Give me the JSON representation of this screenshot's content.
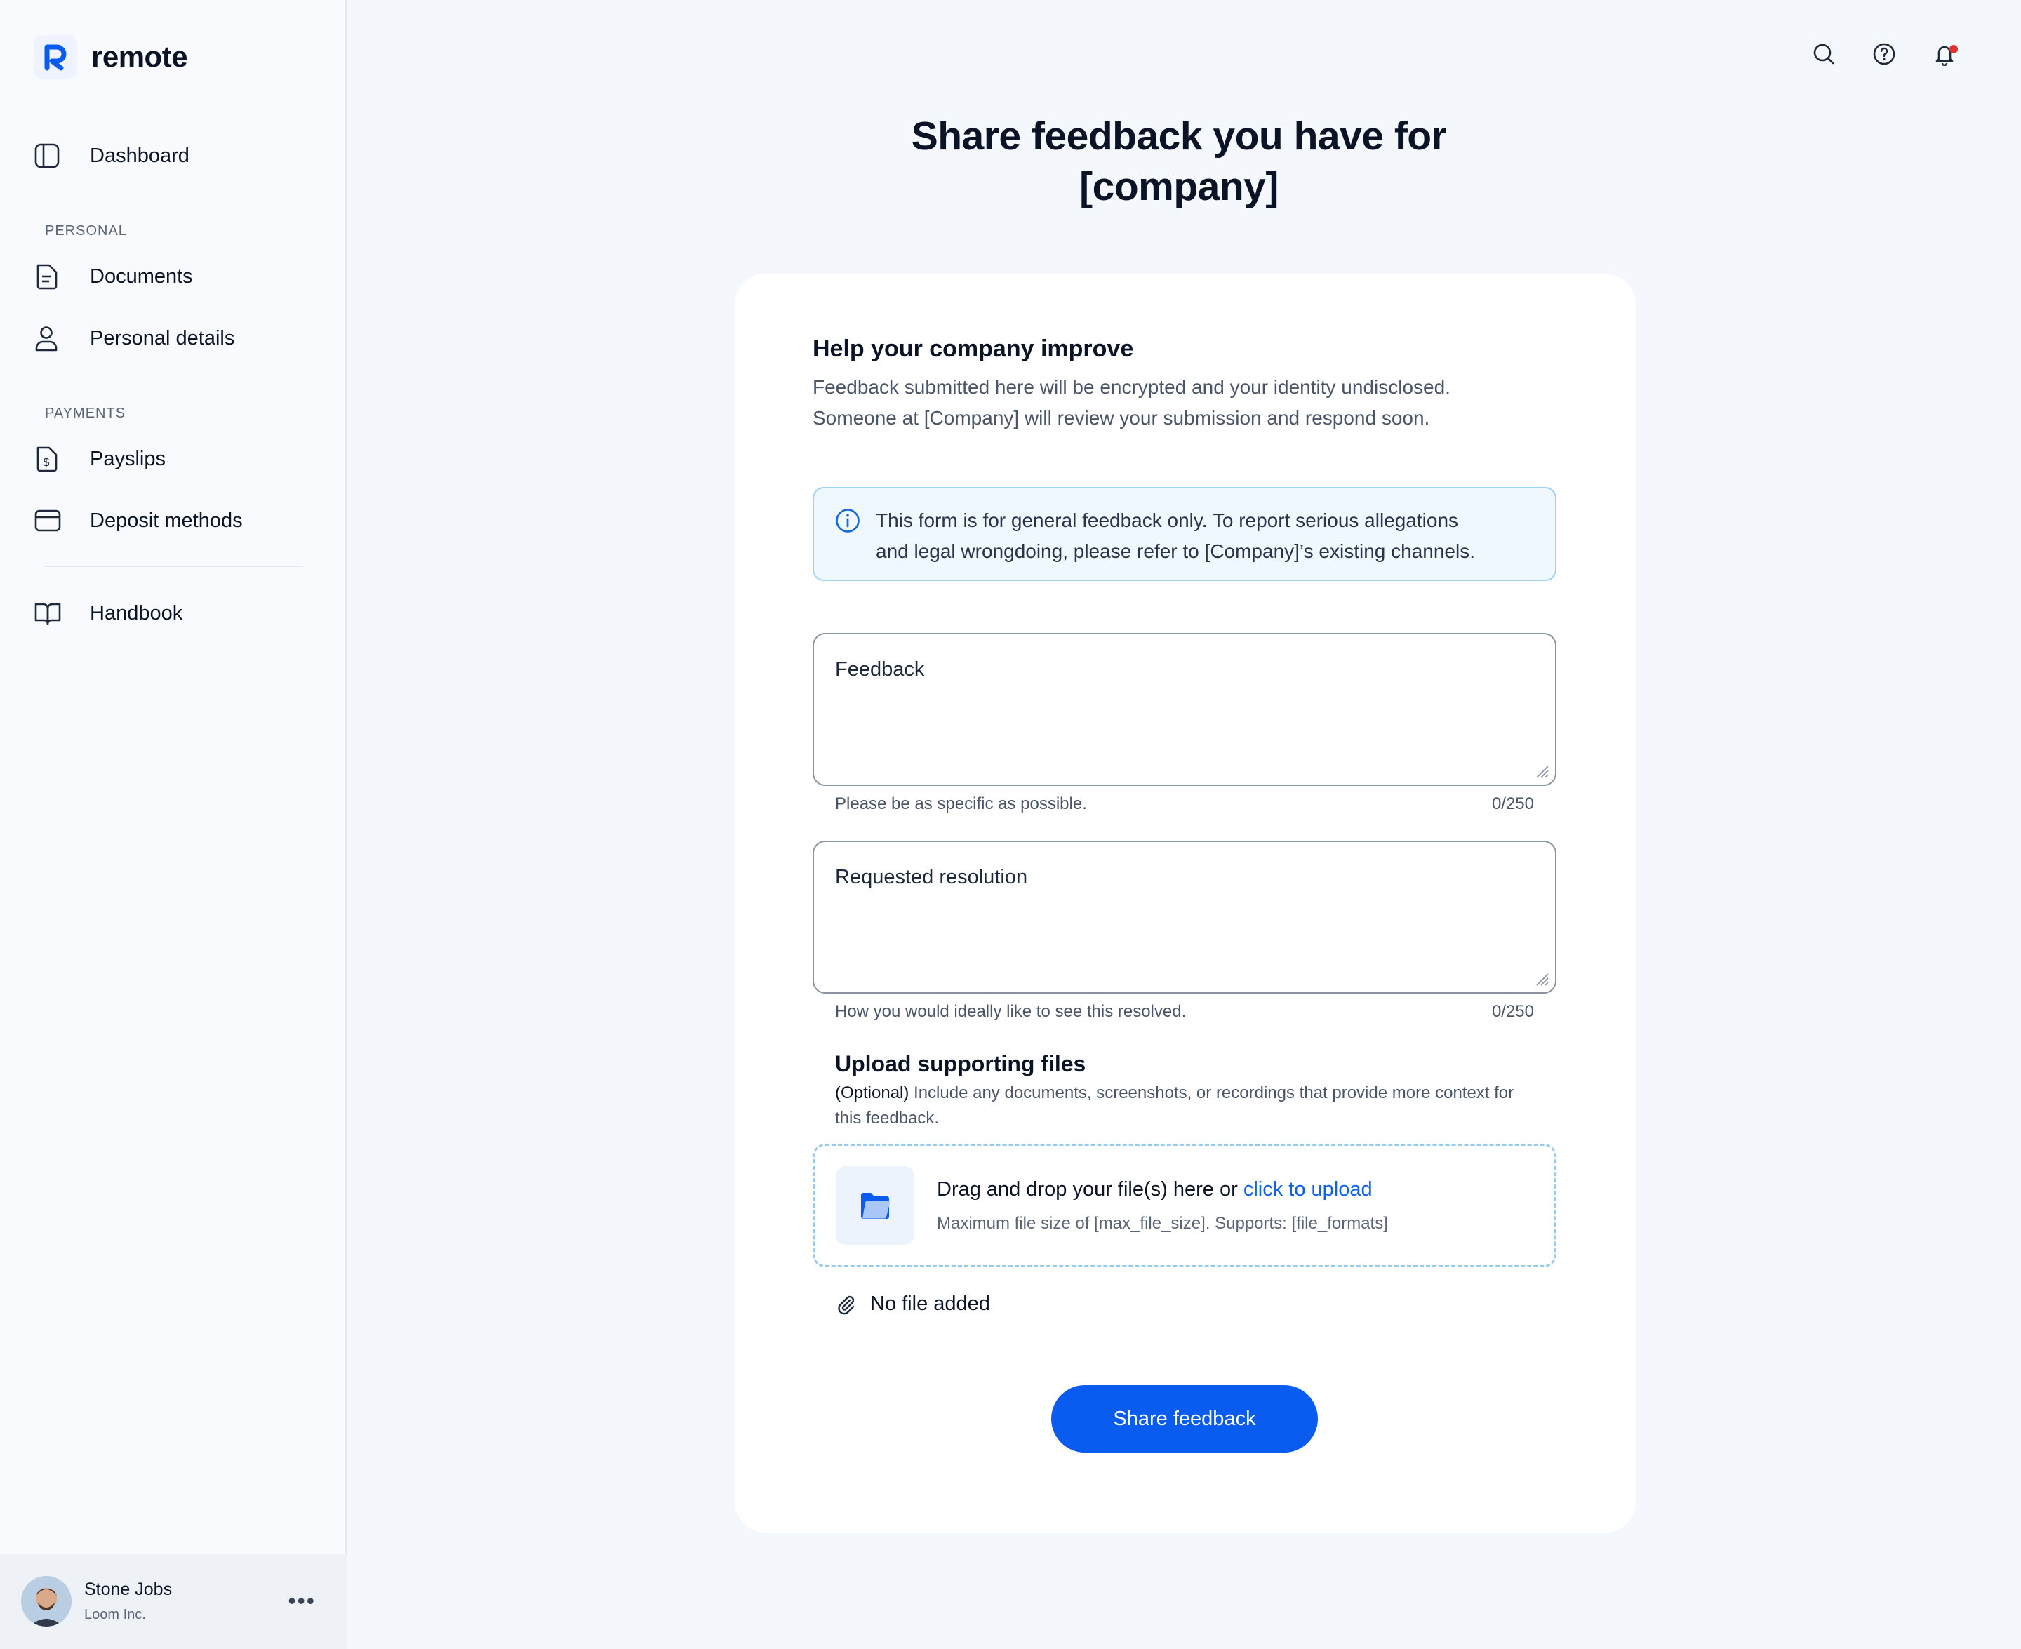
{
  "brand": {
    "name": "remote",
    "accent": "#0a5cf0"
  },
  "sidebar": {
    "dashboard": "Dashboard",
    "sections": {
      "personal": "PERSONAL",
      "payments": "PAYMENTS"
    },
    "items": {
      "documents": "Documents",
      "personal_details": "Personal details",
      "payslips": "Payslips",
      "deposit_methods": "Deposit methods",
      "handbook": "Handbook"
    },
    "user": {
      "name": "Stone Jobs",
      "company": "Loom Inc.",
      "more": "•••"
    }
  },
  "header": {
    "icons": [
      "search-icon",
      "help-icon",
      "bell-icon"
    ]
  },
  "main": {
    "title_line1": "Share feedback you have for",
    "title_line2": "[company]",
    "card": {
      "heading": "Help your company improve",
      "description_line1": "Feedback submitted here will be encrypted and your identity undisclosed.",
      "description_line2": "Someone at [Company] will review your submission and respond soon.",
      "alert_line1": "This form is for general feedback only. To report serious allegations",
      "alert_line2": "and legal wrongdoing, please refer to [Company]’s existing channels.",
      "feedback": {
        "placeholder": "Feedback",
        "helper": "Please be as specific as possible.",
        "count": "0/250"
      },
      "resolution": {
        "placeholder": "Requested resolution",
        "helper": "How you would ideally like to see this resolved.",
        "count": "0/250"
      },
      "upload": {
        "title": "Upload supporting files",
        "optional": "(Optional)",
        "description": " Include any documents, screenshots, or recordings that provide more context for this feedback.",
        "drag": "Drag",
        "and": " and ",
        "drop": "drop",
        "rest": " your file(s) here or ",
        "link": "click to upload",
        "limits": "Maximum file size of [max_file_size]. Supports: [file_formats]",
        "no_file": "No file added"
      },
      "submit_label": "Share feedback"
    }
  }
}
